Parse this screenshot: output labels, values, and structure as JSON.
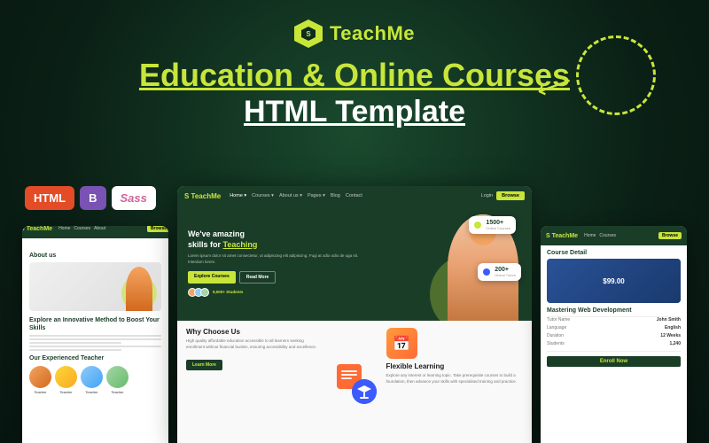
{
  "brand": {
    "name": "TeachMe",
    "name_part1": "Teach",
    "name_part2": "Me"
  },
  "header": {
    "title_line1": "Education & Online Courses",
    "title_line2": "HTML Template"
  },
  "tech_badges": {
    "html": "HTML",
    "bootstrap": "B",
    "sass": "Sass"
  },
  "nav": {
    "links": [
      "Home",
      "Courses",
      "About us",
      "Pages",
      "Blog",
      "Contact"
    ],
    "login": "Login",
    "browse": "Browse"
  },
  "hero": {
    "heading_line1": "We've amazing",
    "heading_line2": "skills for",
    "heading_highlight": "Teaching",
    "subtext": "Lorem ipsum dolor sit amet consectetur, ut adipiscing elit adipiscing. Fugi at odio odio de uga sit. Interdum lorem.",
    "btn_explore": "Explore Courses",
    "btn_read": "Read More",
    "students_count": "9,000+ Students"
  },
  "stats": {
    "courses": {
      "number": "1500+",
      "label": "Online Courses"
    },
    "tutors": {
      "number": "200+",
      "label": "Global Tutors"
    }
  },
  "why_choose": {
    "title": "Why Choose Us",
    "text": "High quality affordable education accessible to all learners seeking enrollment without financial burden, ensuring accessibility and excellence.",
    "btn": "Learn More"
  },
  "flexible": {
    "title": "Flexible Learning",
    "text": "Explore any interest or learning topic. Take prerequisite courses to build a foundation, then advance your skills with specialised training and practice."
  },
  "about": {
    "title": "About us",
    "method_title": "Explore an Innovative Method to Boost Your Skills",
    "teacher_section": "Our Experienced Teacher"
  },
  "course_detail": {
    "title": "Course Detail",
    "price": "$99.00",
    "course_title": "Mastering Web Development",
    "fields": [
      {
        "label": "Tutor Name",
        "value": "John Smith"
      },
      {
        "label": "Language",
        "value": "English"
      },
      {
        "label": "Duration",
        "value": "12 Weeks"
      },
      {
        "label": "Students",
        "value": "1,240"
      }
    ],
    "enroll_btn": "Enroll Now"
  },
  "colors": {
    "brand_green": "#1a3d27",
    "brand_dark": "#0d2b1e",
    "accent_yellow": "#c8e63a",
    "white": "#ffffff"
  }
}
